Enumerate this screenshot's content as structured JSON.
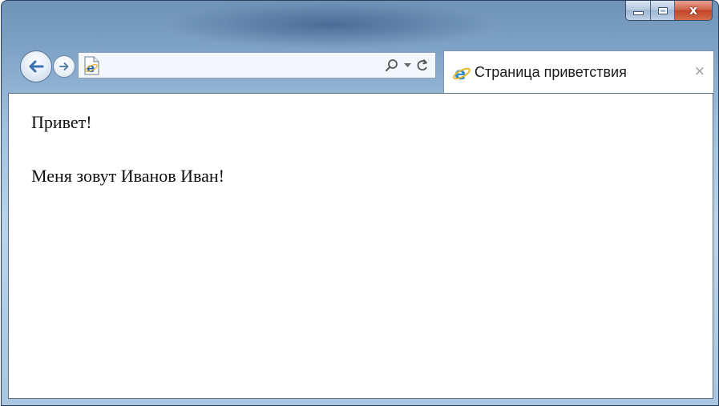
{
  "window": {
    "caption": {
      "minimize_icon": "minimize-icon",
      "maximize_icon": "maximize-icon",
      "close_glyph": "x"
    }
  },
  "toolbar": {
    "back_icon": "back-arrow-icon",
    "forward_icon": "forward-arrow-icon",
    "address": {
      "value": "",
      "page_icon": "ie-page-icon"
    },
    "search_icon": "search-icon",
    "dropdown_icon": "dropdown-arrow-icon",
    "refresh_icon": "refresh-icon"
  },
  "tab": {
    "icon": "ie-logo-icon",
    "label": "Страница приветствия",
    "close_glyph": "×"
  },
  "page": {
    "paragraphs": [
      "Привет!",
      "Меня зовут Иванов Иван!"
    ]
  },
  "colors": {
    "accent_blue": "#1e64c8",
    "close_red": "#c24526",
    "frame_blue": "#9ec0de"
  }
}
